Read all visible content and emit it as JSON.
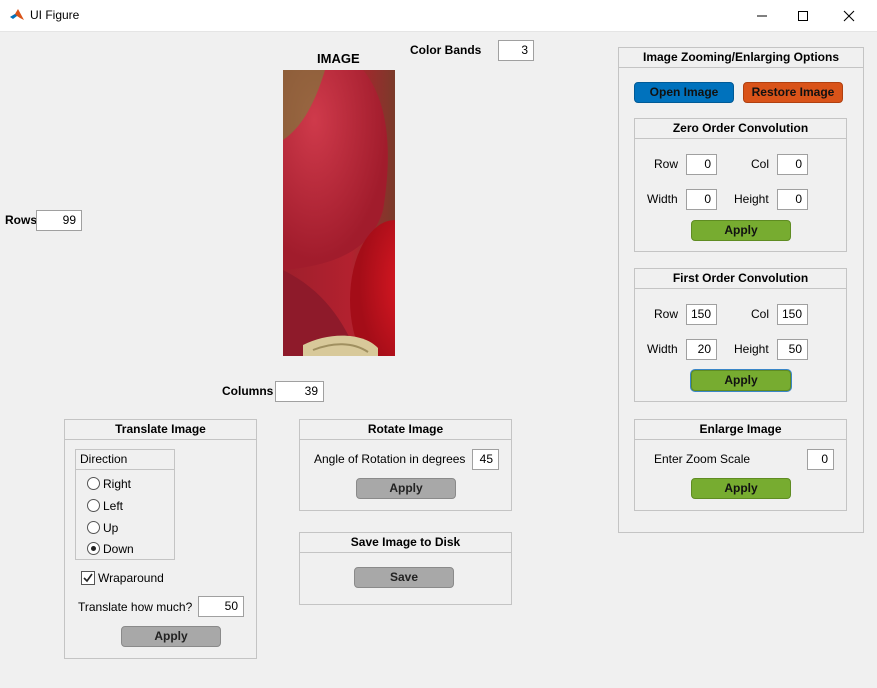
{
  "window": {
    "title": "UI Figure",
    "icon": "matlab-icon"
  },
  "image_area": {
    "title": "IMAGE",
    "color_bands_label": "Color Bands",
    "color_bands_value": "3",
    "rows_label": "Rows",
    "rows_value": "99",
    "columns_label": "Columns",
    "columns_value": "39"
  },
  "zoom_options": {
    "title": "Image Zooming/Enlarging Options",
    "open_label": "Open Image",
    "restore_label": "Restore Image",
    "zero_order": {
      "title": "Zero Order Convolution",
      "row_label": "Row",
      "row_value": "0",
      "col_label": "Col",
      "col_value": "0",
      "width_label": "Width",
      "width_value": "0",
      "height_label": "Height",
      "height_value": "0",
      "apply_label": "Apply"
    },
    "first_order": {
      "title": "First Order Convolution",
      "row_label": "Row",
      "row_value": "150",
      "col_label": "Col",
      "col_value": "150",
      "width_label": "Width",
      "width_value": "20",
      "height_label": "Height",
      "height_value": "50",
      "apply_label": "Apply"
    },
    "enlarge": {
      "title": "Enlarge Image",
      "zoom_label": "Enter Zoom Scale",
      "zoom_value": "0",
      "apply_label": "Apply"
    }
  },
  "translate": {
    "title": "Translate Image",
    "direction_title": "Direction",
    "options": [
      "Right",
      "Left",
      "Up",
      "Down"
    ],
    "selected": "Down",
    "wraparound_label": "Wraparound",
    "wraparound_checked": true,
    "amount_label": "Translate how much?",
    "amount_value": "50",
    "apply_label": "Apply"
  },
  "rotate": {
    "title": "Rotate Image",
    "angle_label": "Angle of Rotation in degrees",
    "angle_value": "45",
    "apply_label": "Apply"
  },
  "save": {
    "title": "Save Image to Disk",
    "save_label": "Save"
  },
  "colors": {
    "blue": "#0072bd",
    "orange": "#d95319",
    "green": "#77ac30",
    "gray": "#a8a8a8"
  }
}
